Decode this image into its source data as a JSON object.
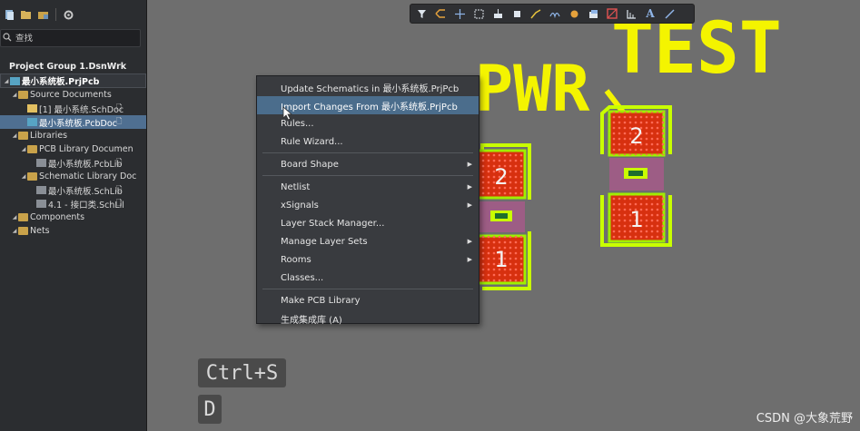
{
  "panel": {
    "search_placeholder": "查找",
    "tree": [
      {
        "label": "Project Group 1.DsnWrk",
        "kind": "group",
        "indent": 0
      },
      {
        "label": "最小系统板.PrjPcb",
        "kind": "project",
        "indent": 0
      },
      {
        "label": "Source Documents",
        "kind": "folder",
        "indent": 1
      },
      {
        "label": "[1] 最小系统.SchDoc",
        "kind": "sch",
        "indent": 2
      },
      {
        "label": "最小系统板.PcbDoc",
        "kind": "pcb",
        "indent": 2,
        "selected": true
      },
      {
        "label": "Libraries",
        "kind": "folder",
        "indent": 1
      },
      {
        "label": "PCB Library Documen",
        "kind": "folder",
        "indent": 2
      },
      {
        "label": "最小系统板.PcbLib",
        "kind": "lib",
        "indent": 3
      },
      {
        "label": "Schematic Library Doc",
        "kind": "folder",
        "indent": 2
      },
      {
        "label": "最小系统板.SchLib",
        "kind": "lib",
        "indent": 3
      },
      {
        "label": "4.1   - 接口类.SchLil",
        "kind": "lib",
        "indent": 3
      },
      {
        "label": "Components",
        "kind": "folder",
        "indent": 1
      },
      {
        "label": "Nets",
        "kind": "folder",
        "indent": 1
      }
    ]
  },
  "canvas": {
    "silk_text_1": "TEST",
    "silk_text_2": "PWR",
    "pad_labels": [
      "2",
      "1",
      "2",
      "1"
    ]
  },
  "context_menu": {
    "groups": [
      [
        {
          "label": "Update Schematics in 最小系统板.PrjPcb"
        },
        {
          "label": "Import Changes From 最小系统板.PrjPcb",
          "highlighted": true
        },
        {
          "label": "Rules..."
        },
        {
          "label": "Rule Wizard..."
        }
      ],
      [
        {
          "label": "Board Shape",
          "submenu": true
        }
      ],
      [
        {
          "label": "Netlist",
          "submenu": true
        },
        {
          "label": "xSignals",
          "submenu": true
        },
        {
          "label": "Layer Stack Manager..."
        },
        {
          "label": "Manage Layer Sets",
          "submenu": true
        },
        {
          "label": "Rooms",
          "submenu": true
        },
        {
          "label": "Classes..."
        }
      ],
      [
        {
          "label": "Make PCB Library"
        },
        {
          "label": "生成集成库 (A)"
        }
      ]
    ]
  },
  "shortcuts": {
    "combo": "Ctrl+S",
    "key": "D"
  },
  "watermark": "CSDN @大象荒野",
  "colors": {
    "silkscreen": "#f4f400",
    "pad_copper": "#d7300f",
    "board_bg": "#6e6e6e",
    "menu_highlight": "#4b6d8c",
    "selection": "#4f6f91"
  }
}
